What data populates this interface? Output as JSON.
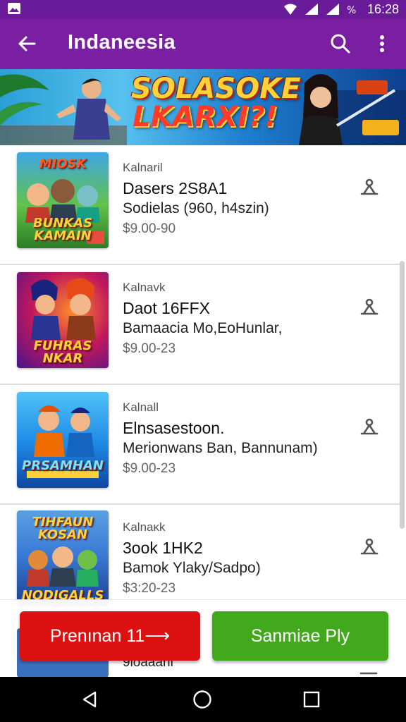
{
  "status_bar": {
    "time": "16:28",
    "icons": [
      "image-icon",
      "hotspot-icon",
      "signal-icon",
      "signal-icon",
      "data-percent-icon"
    ]
  },
  "app_bar": {
    "title": "Indaneesia",
    "back_icon": "arrow-left-icon",
    "search_icon": "search-icon",
    "more_icon": "more-vertical-icon"
  },
  "banner": {
    "line1": "SOLASOKE",
    "line2": "LKARXI?!"
  },
  "items": [
    {
      "thumb_title": "BUNKAS KAMAIN",
      "thumb_top": "MIOSK",
      "subtitle": "Kalnaril",
      "title": "Dasers 2S8A1",
      "description": "Sodielas (960, h4szin)",
      "price": "$9.00-90"
    },
    {
      "thumb_title": "FUHRAS NKAR",
      "thumb_top": "",
      "subtitle": "Kalnavk",
      "title": "Daot 16FFX",
      "description": "Bamaacia Mo,EoHunlar,",
      "price": "$9.00-23"
    },
    {
      "thumb_title": "PRSAMHAN",
      "thumb_top": "",
      "subtitle": "Kalnall",
      "title": "Elnsasestoon.",
      "description": "Merionwans Ban, Bannunam)",
      "price": "$9.00-23"
    },
    {
      "thumb_title": "NODIGALLS",
      "thumb_top": "TIHFAUN KOSAN",
      "subtitle": "Kalnaκk",
      "title": "3ook 1HK2",
      "description": "Bamok Ylaky/Sadpo)",
      "price": "$3:20-23"
    }
  ],
  "peek_item": {
    "subtitle": "9loaaaril"
  },
  "actions": {
    "premium_label": "Prenınan 11⟶",
    "green_label": "Sanmiae Ply"
  },
  "colors": {
    "status_bar": "#6a1b9a",
    "app_bar": "#7b1fa2",
    "premium_button": "#dd1111",
    "green_button": "#43a91c"
  }
}
